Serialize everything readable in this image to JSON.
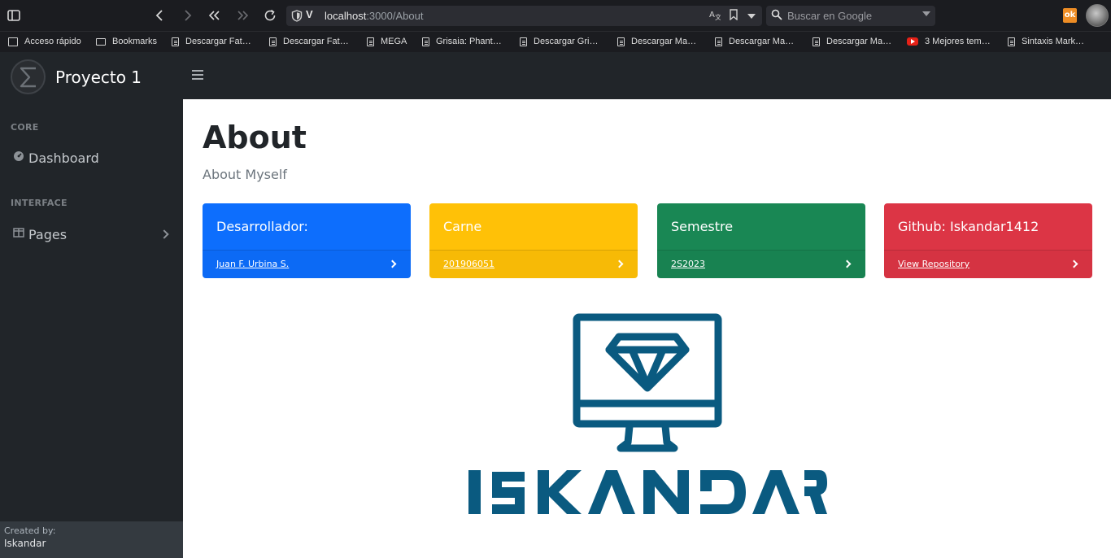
{
  "browser": {
    "url_host": "localhost",
    "url_path": ":3000/About",
    "search_placeholder": "Buscar en Google",
    "bookmarks": [
      {
        "label": "Acceso rápido",
        "icon": "quick-access-icon"
      },
      {
        "label": "Bookmarks",
        "icon": "folder-icon"
      },
      {
        "label": "Descargar Fat…",
        "icon": "page-icon"
      },
      {
        "label": "Descargar Fat…",
        "icon": "page-icon"
      },
      {
        "label": "MEGA",
        "icon": "page-icon"
      },
      {
        "label": "Grisaia: Phant…",
        "icon": "page-icon"
      },
      {
        "label": "Descargar Gri…",
        "icon": "page-icon"
      },
      {
        "label": "Descargar Ma…",
        "icon": "page-icon"
      },
      {
        "label": "Descargar Ma…",
        "icon": "page-icon"
      },
      {
        "label": "Descargar Ma…",
        "icon": "page-icon"
      },
      {
        "label": "3 Mejores tem…",
        "icon": "youtube-icon"
      },
      {
        "label": "Sintaxis Mark…",
        "icon": "page-icon"
      }
    ]
  },
  "app": {
    "brand": "Proyecto 1",
    "sidebar": {
      "sections": [
        {
          "heading": "CORE",
          "items": [
            {
              "label": "Dashboard",
              "icon": "dashboard-icon"
            }
          ]
        },
        {
          "heading": "INTERFACE",
          "items": [
            {
              "label": "Pages",
              "icon": "columns-icon",
              "expandable": true
            }
          ]
        }
      ],
      "footer_caption": "Created by:",
      "footer_name": "Iskandar"
    }
  },
  "page": {
    "title": "About",
    "subtitle": "About Myself",
    "cards": [
      {
        "title": "Desarrollador:",
        "link": "Juan F. Urbina S.",
        "color": "#0d6efd"
      },
      {
        "title": "Carne",
        "link": "201906051",
        "color": "#ffc107"
      },
      {
        "title": "Semestre",
        "link": "2S2023",
        "color": "#198754"
      },
      {
        "title": "Github: Iskandar1412",
        "link": "View Repository",
        "color": "#dc3545"
      }
    ],
    "logo_text": "ISKANDAR",
    "logo_color": "#0a5a80"
  }
}
